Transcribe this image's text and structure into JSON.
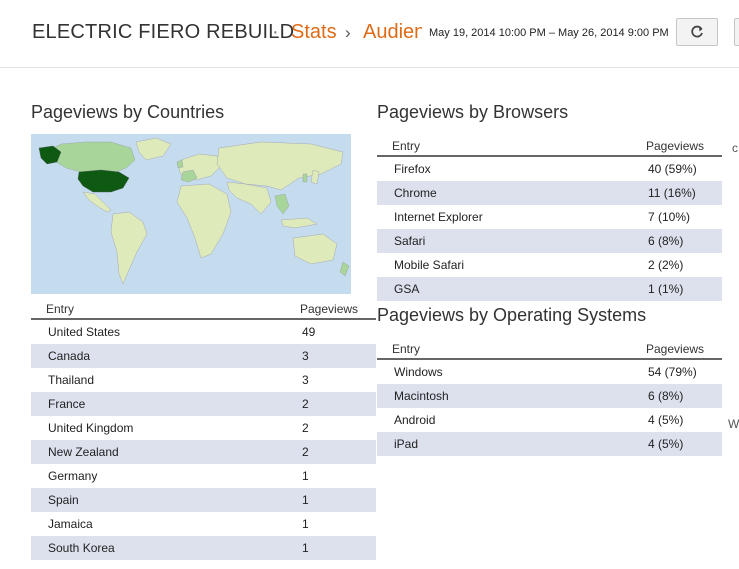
{
  "header": {
    "blog_title": "ELECTRIC FIERO REBUILD",
    "separator": "·",
    "crumb_stats": "Stats",
    "crumb_arrow": "›",
    "crumb_audience": "Audience",
    "date_range": "May 19, 2014 10:00 PM – May 26, 2014 9:00 PM",
    "refresh_icon": "refresh-icon"
  },
  "countries": {
    "title": "Pageviews by Countries",
    "col_entry": "Entry",
    "col_pageviews": "Pageviews",
    "map_highlight_color": "#0f5a12",
    "rows": [
      {
        "entry": "United States",
        "pageviews": "49"
      },
      {
        "entry": "Canada",
        "pageviews": "3"
      },
      {
        "entry": "Thailand",
        "pageviews": "3"
      },
      {
        "entry": "France",
        "pageviews": "2"
      },
      {
        "entry": "United Kingdom",
        "pageviews": "2"
      },
      {
        "entry": "New Zealand",
        "pageviews": "2"
      },
      {
        "entry": "Germany",
        "pageviews": "1"
      },
      {
        "entry": "Spain",
        "pageviews": "1"
      },
      {
        "entry": "Jamaica",
        "pageviews": "1"
      },
      {
        "entry": "South Korea",
        "pageviews": "1"
      }
    ]
  },
  "browsers": {
    "title": "Pageviews by Browsers",
    "col_entry": "Entry",
    "col_pageviews": "Pageviews",
    "rows": [
      {
        "entry": "Firefox",
        "pageviews": "40 (59%)"
      },
      {
        "entry": "Chrome",
        "pageviews": "11 (16%)"
      },
      {
        "entry": "Internet Explorer",
        "pageviews": "7 (10%)"
      },
      {
        "entry": "Safari",
        "pageviews": "6 (8%)"
      },
      {
        "entry": "Mobile Safari",
        "pageviews": "2 (2%)"
      },
      {
        "entry": "GSA",
        "pageviews": "1 (1%)"
      }
    ]
  },
  "os": {
    "title": "Pageviews by Operating Systems",
    "col_entry": "Entry",
    "col_pageviews": "Pageviews",
    "rows": [
      {
        "entry": "Windows",
        "pageviews": "54 (79%)"
      },
      {
        "entry": "Macintosh",
        "pageviews": "6 (8%)"
      },
      {
        "entry": "Android",
        "pageviews": "4 (5%)"
      },
      {
        "entry": "iPad",
        "pageviews": "4 (5%)"
      }
    ]
  },
  "edge": {
    "browsers_cut": "c",
    "os_cut": "W"
  }
}
